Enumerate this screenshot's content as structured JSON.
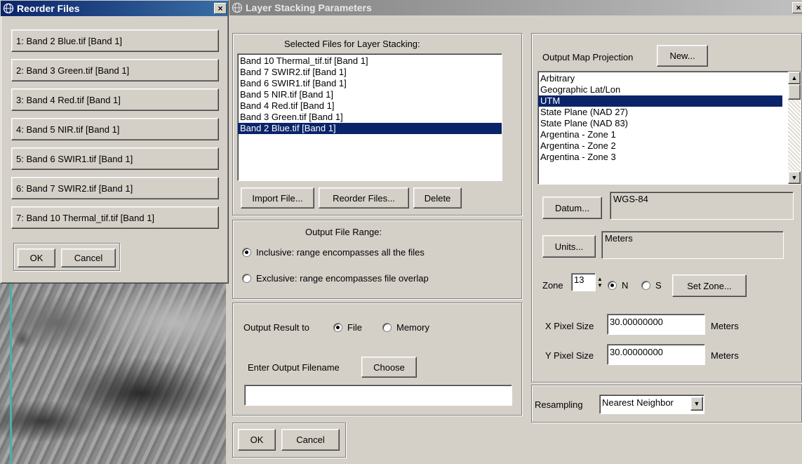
{
  "reorder": {
    "title": "Reorder Files",
    "close": "×",
    "items": [
      "1: Band 2 Blue.tif [Band 1]",
      "2: Band 3 Green.tif [Band 1]",
      "3: Band 4 Red.tif [Band 1]",
      "4: Band 5 NIR.tif [Band 1]",
      "5: Band 6 SWIR1.tif [Band 1]",
      "6: Band 7 SWIR2.tif [Band 1]",
      "7: Band 10 Thermal_tif.tif [Band 1]"
    ],
    "ok": "OK",
    "cancel": "Cancel"
  },
  "layer": {
    "title": "Layer Stacking Parameters",
    "close": "×",
    "selected_files_label": "Selected Files for Layer Stacking:",
    "files": [
      "Band 10 Thermal_tif.tif [Band 1]",
      "Band 7 SWIR2.tif [Band 1]",
      "Band 6 SWIR1.tif [Band 1]",
      "Band 5 NIR.tif [Band 1]",
      "Band 4 Red.tif [Band 1]",
      "Band 3 Green.tif [Band 1]",
      "Band 2 Blue.tif [Band 1]"
    ],
    "selected_file_index": 6,
    "import_file": "Import File...",
    "reorder_files": "Reorder Files...",
    "delete": "Delete",
    "range_label": "Output File Range:",
    "inclusive": "Inclusive: range encompasses all the files",
    "exclusive": "Exclusive: range encompasses file overlap",
    "range_selected": "inclusive",
    "output_to_label": "Output Result to",
    "file_option": "File",
    "memory_option": "Memory",
    "output_selected": "file",
    "filename_label": "Enter Output Filename",
    "choose": "Choose",
    "filename_value": "",
    "ok": "OK",
    "cancel": "Cancel",
    "projection_label": "Output Map Projection",
    "new_button": "New...",
    "projections": [
      "Arbitrary",
      "Geographic Lat/Lon",
      "UTM",
      "State Plane (NAD 27)",
      "State Plane (NAD 83)",
      "Argentina - Zone 1",
      "Argentina - Zone 2",
      "Argentina - Zone 3"
    ],
    "selected_projection_index": 2,
    "datum_button": "Datum...",
    "datum_value": "WGS-84",
    "units_button": "Units...",
    "units_value": "Meters",
    "zone_label": "Zone",
    "zone_value": "13",
    "n_label": "N",
    "s_label": "S",
    "hemisphere_selected": "N",
    "set_zone": "Set Zone...",
    "x_pixel_label": "X Pixel Size",
    "x_pixel_value": "30.00000000",
    "x_pixel_units": "Meters",
    "y_pixel_label": "Y Pixel Size",
    "y_pixel_value": "30.00000000",
    "y_pixel_units": "Meters",
    "resampling_label": "Resampling",
    "resampling_value": "Nearest Neighbor"
  },
  "colors": {
    "title_active": "#0a246a",
    "title_inactive": "#808080",
    "selection": "#0a246a",
    "face": "#d4d0c8"
  }
}
